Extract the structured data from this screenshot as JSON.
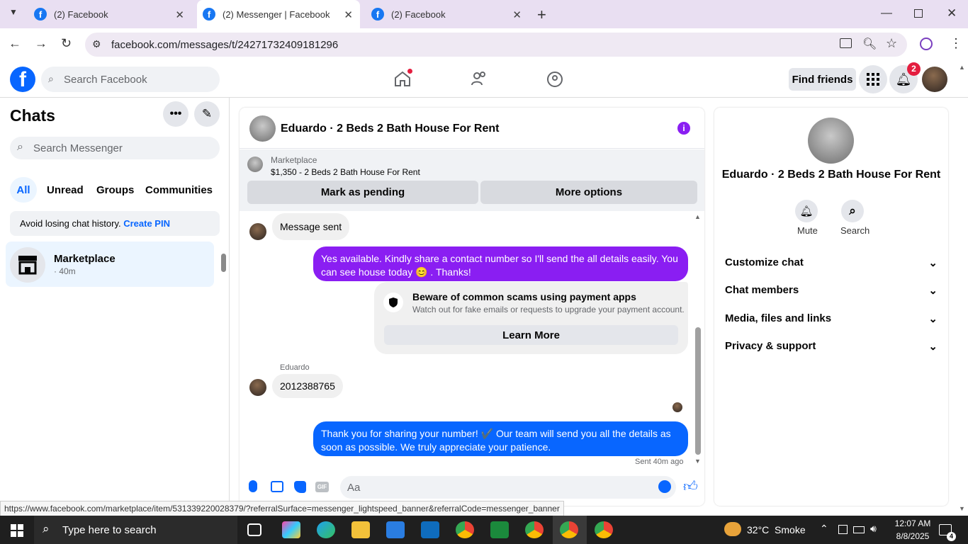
{
  "browser": {
    "tabs": [
      {
        "label": "(2) Facebook"
      },
      {
        "label": "(2) Messenger | Facebook"
      },
      {
        "label": "(2) Facebook"
      }
    ],
    "url": "facebook.com/messages/t/24271732409181296",
    "status_url": "https://www.facebook.com/marketplace/item/531339220028379/?referralSurface=messenger_lightspeed_banner&referralCode=messenger_banner"
  },
  "header": {
    "search_placeholder": "Search Facebook",
    "find_friends": "Find friends",
    "notification_count": "2"
  },
  "sidebar": {
    "title": "Chats",
    "search_placeholder": "Search Messenger",
    "filters": [
      "All",
      "Unread",
      "Groups",
      "Communities"
    ],
    "pin_text": "Avoid losing chat history.",
    "pin_link": "Create PIN",
    "chat": {
      "name": "Marketplace",
      "time": "· 40m"
    }
  },
  "conversation": {
    "title": "Eduardo · 2 Beds 2 Bath House For Rent",
    "marketplace_label": "Marketplace",
    "listing": "$1,350 - 2 Beds 2 Bath House For Rent",
    "mark_pending": "Mark as pending",
    "more_options": "More options",
    "messages": {
      "msg_sent": "Message sent",
      "out1": "Yes available. Kindly share a contact number so I'll send the all details easily. You can see house today 😊 . Thanks!",
      "scam_title": "Beware of common scams using payment apps",
      "scam_body": "Watch out for fake emails or requests to upgrade your payment account.",
      "learn_more": "Learn More",
      "sender": "Eduardo",
      "in_number": "2012388765",
      "out2": "Thank you for sharing your number! ✔️ Our team will send you all the details as soon as possible. We truly appreciate your patience.",
      "sent_status": "Sent 40m ago"
    },
    "composer_placeholder": "Aa"
  },
  "right_panel": {
    "title": "Eduardo · 2 Beds 2 Bath House For Rent",
    "mute": "Mute",
    "search": "Search",
    "sections": [
      "Customize chat",
      "Chat members",
      "Media, files and links",
      "Privacy & support"
    ]
  },
  "taskbar": {
    "search_placeholder": "Type here to search",
    "weather": "32°C  Smoke",
    "time": "12:07 AM",
    "date": "8/8/2025",
    "notif_count": "4"
  },
  "colors": {
    "fb_blue": "#0866ff",
    "purple": "#8a1ef2",
    "tabbar": "#e9dff2"
  }
}
